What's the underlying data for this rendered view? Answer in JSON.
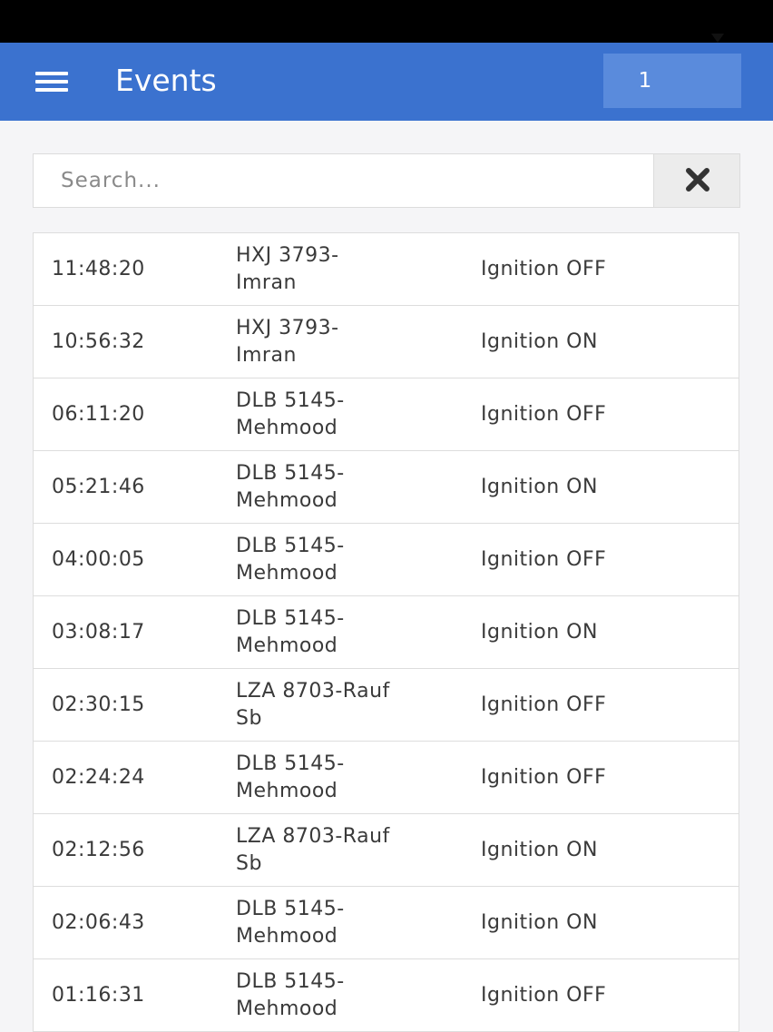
{
  "header": {
    "title": "Events",
    "menu_icon": "hamburger-menu-icon",
    "page_select": {
      "value": "1",
      "icon": "caret-down-icon"
    }
  },
  "search": {
    "placeholder": "Search...",
    "value": "",
    "clear_icon": "close-icon"
  },
  "events": [
    {
      "time": "11:48:20",
      "vehicle_line1": "HXJ 3793-",
      "vehicle_line2": "Imran",
      "event": "Ignition OFF"
    },
    {
      "time": "10:56:32",
      "vehicle_line1": "HXJ 3793-",
      "vehicle_line2": "Imran",
      "event": "Ignition ON"
    },
    {
      "time": "06:11:20",
      "vehicle_line1": "DLB 5145-",
      "vehicle_line2": "Mehmood",
      "event": "Ignition OFF"
    },
    {
      "time": "05:21:46",
      "vehicle_line1": "DLB 5145-",
      "vehicle_line2": "Mehmood",
      "event": "Ignition ON"
    },
    {
      "time": "04:00:05",
      "vehicle_line1": "DLB 5145-",
      "vehicle_line2": "Mehmood",
      "event": "Ignition OFF"
    },
    {
      "time": "03:08:17",
      "vehicle_line1": "DLB 5145-",
      "vehicle_line2": "Mehmood",
      "event": "Ignition ON"
    },
    {
      "time": "02:30:15",
      "vehicle_line1": "LZA 8703-Rauf",
      "vehicle_line2": "Sb",
      "event": "Ignition OFF"
    },
    {
      "time": "02:24:24",
      "vehicle_line1": "DLB 5145-",
      "vehicle_line2": "Mehmood",
      "event": "Ignition OFF"
    },
    {
      "time": "02:12:56",
      "vehicle_line1": "LZA 8703-Rauf",
      "vehicle_line2": "Sb",
      "event": "Ignition ON"
    },
    {
      "time": "02:06:43",
      "vehicle_line1": "DLB 5145-",
      "vehicle_line2": "Mehmood",
      "event": "Ignition ON"
    },
    {
      "time": "01:16:31",
      "vehicle_line1": "DLB 5145-",
      "vehicle_line2": "Mehmood",
      "event": "Ignition OFF"
    }
  ],
  "colors": {
    "app_bar": "#3b72cf",
    "select_background": "#5a8bdc",
    "status_bar": "#000000",
    "page_background": "#f5f5f7"
  }
}
